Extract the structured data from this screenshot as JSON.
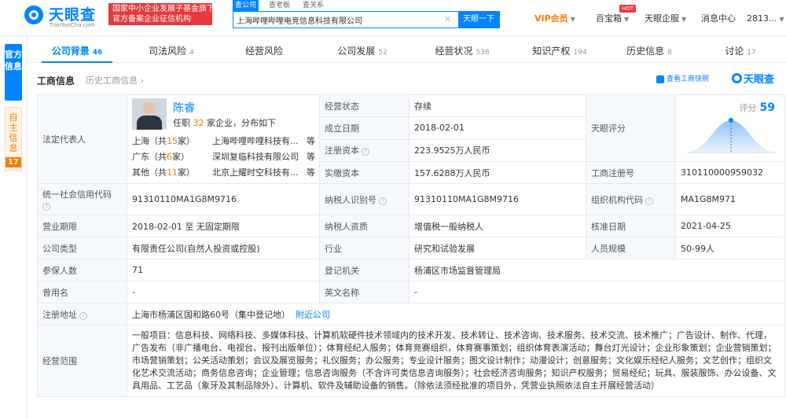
{
  "header": {
    "logo_name": "天眼查",
    "logo_sub": "TianYanCha.com",
    "gov_badge_line1": "国家中小企业发展子基金旗下",
    "gov_badge_line2": "官方备案企业征信机构",
    "search_tabs": [
      "查公司",
      "查老板",
      "查关系"
    ],
    "search_value": "上海哔哩哔哩电竞信息科技有限公司",
    "search_button": "天眼一下",
    "vip": "VIP会员",
    "hot": "HOT",
    "baibaoxiang": "百宝箱",
    "enterprise": "天眼企服",
    "messages": "消息中心",
    "user": "2813..."
  },
  "side": {
    "official": "官方信息",
    "self": "自主信息",
    "self_count": "17"
  },
  "tabs": [
    {
      "label": "公司背景",
      "count": "46"
    },
    {
      "label": "司法风险",
      "count": "4"
    },
    {
      "label": "经营风险",
      "count": ""
    },
    {
      "label": "公司发展",
      "count": "52"
    },
    {
      "label": "经营状况",
      "count": "538"
    },
    {
      "label": "知识产权",
      "count": "194"
    },
    {
      "label": "历史信息",
      "count": "8"
    },
    {
      "label": "讨论",
      "count": "17"
    }
  ],
  "section": {
    "title": "工商信息",
    "history": "历史工商信息 ›",
    "view_report": "查看工商快照",
    "brand": "天眼查"
  },
  "info": {
    "legal_rep_label": "法定代表人",
    "rep_name": "陈睿",
    "rep_roles_prefix": "任职",
    "rep_roles_count": "32",
    "rep_roles_suffix": "家企业，分布如下",
    "rep_regions": [
      {
        "region": "上海",
        "count": "15",
        "company": "上海哔哩哔哩科技有...",
        "more": "等"
      },
      {
        "region": "广东",
        "count": "6",
        "company": "深圳复临科技有限公司",
        "more": "等"
      },
      {
        "region": "其他",
        "count": "11",
        "company": "北京上耀时空科技有...",
        "more": "等"
      }
    ],
    "status_label": "经营状态",
    "status": "存续",
    "founded_label": "成立日期",
    "founded": "2018-02-01",
    "reg_capital_label": "注册资本",
    "reg_capital": "223.9525万人民币",
    "paid_capital_label": "实缴资本",
    "paid_capital": "157.6288万人民币",
    "score_label": "天眼评分",
    "score_prefix": "评分",
    "score": "59",
    "reg_no_label": "工商注册号",
    "reg_no": "310110000959032",
    "credit_code_label": "统一社会信用代码",
    "credit_code": "91310110MA1G8M9716",
    "taxpayer_id_label": "纳税人识别号",
    "taxpayer_id": "91310110MA1G8M9716",
    "org_code_label": "组织机构代码",
    "org_code": "MA1G8M971",
    "term_label": "营业期限",
    "term": "2018-02-01  至  无固定期限",
    "taxpayer_qual_label": "纳税人资质",
    "taxpayer_qual": "增值税一般纳税人",
    "approval_label": "核准日期",
    "approval": "2021-04-25",
    "type_label": "公司类型",
    "type": "有限责任公司(自然人投资或控股)",
    "industry_label": "行业",
    "industry": "研究和试验发展",
    "staff_label": "人员规模",
    "staff": "50-99人",
    "insured_label": "参保人数",
    "insured": "71",
    "authority_label": "登记机关",
    "authority": "杨浦区市场监督管理局",
    "former_name_label": "曾用名",
    "former_name": "-",
    "english_name_label": "英文名称",
    "english_name": "-",
    "address_label": "注册地址",
    "address": "上海市杨浦区国和路60号（集中登记地）",
    "nearby": "附近公司",
    "scope_label": "经营范围",
    "scope": "一般项目：信息科技、网络科技、多媒体科技、计算机软硬件技术领域内的技术开发、技术转让、技术咨询、技术服务、技术交流、技术推广；广告设计、制作、代理，广告发布（非广播电台、电视台、报刊出版单位）；体育经纪人服务；体育竞赛组织，体育赛事策划；组织体育表演活动；舞台灯光设计；企业形象策划；企业营销策划；市场营销策划；公关活动策划；会议及展览服务；礼仪服务；办公服务；专业设计服务；图文设计制作；动漫设计；创意服务；文化娱乐经纪人服务；文艺创作；组织文化艺术交流活动；商务信息咨询；企业管理；信息咨询服务（不含许可类信息咨询服务）；社会经济咨询服务；知识产权服务；贸易经纪；玩具、服装服饰、办公设备、文具用品、工艺品（象牙及其制品除外）、计算机、软件及辅助设备的销售。（除依法须经批准的项目外，凭营业执照依法自主开展经营活动）"
  }
}
